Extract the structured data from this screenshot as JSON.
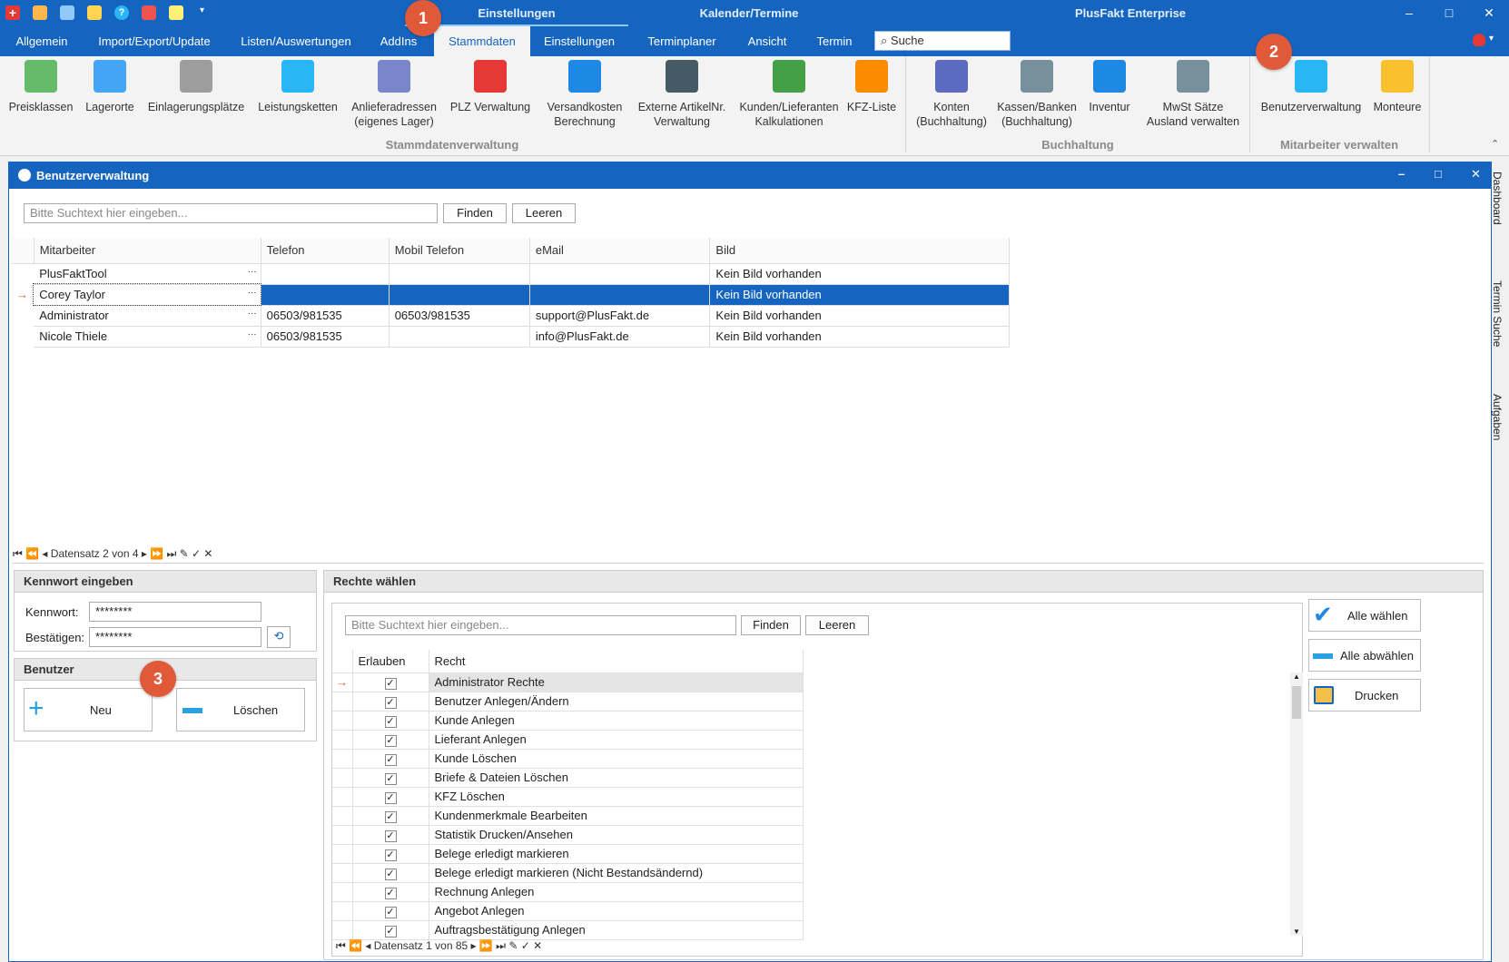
{
  "titlebar": {
    "context_tab1": "Einstellungen",
    "context_tab2": "Kalender/Termine",
    "app_title": "PlusFakt Enterprise"
  },
  "ribbon_tabs": [
    "Allgemein",
    "Import/Export/Update",
    "Listen/Auswertungen",
    "AddIns",
    "Stammdaten",
    "Einstellungen",
    "Terminplaner",
    "Ansicht",
    "Termin"
  ],
  "search_label": "Suche",
  "ribbon": {
    "buttons": [
      {
        "label": "Preisklassen",
        "icon": "money-icon"
      },
      {
        "label": "Lagerorte",
        "icon": "factory-icon"
      },
      {
        "label": "Einlagerungsplätze",
        "icon": "warehouse-icon"
      },
      {
        "label": "Leistungsketten",
        "icon": "chain-icon"
      },
      {
        "label": "Anlieferadressen\n(eigenes Lager)",
        "icon": "delivery-address-icon"
      },
      {
        "label": "PLZ Verwaltung",
        "icon": "plz-icon"
      },
      {
        "label": "Versandkosten\nBerechnung",
        "icon": "truck-icon"
      },
      {
        "label": "Externe ArtikelNr.\nVerwaltung",
        "icon": "barcode-icon"
      },
      {
        "label": "Kunden/Lieferanten\nKalkulationen",
        "icon": "calc-icon"
      },
      {
        "label": "KFZ-Liste",
        "icon": "car-icon"
      },
      {
        "label": "Konten\n(Buchhaltung)",
        "icon": "bank-icon"
      },
      {
        "label": "Kassen/Banken\n(Buchhaltung)",
        "icon": "cash-register-icon"
      },
      {
        "label": "Inventur",
        "icon": "forklift-icon"
      },
      {
        "label": "MwSt Sätze\nAusland verwalten",
        "icon": "tax-register-icon"
      },
      {
        "label": "Benutzerverwaltung",
        "icon": "user-management-icon"
      },
      {
        "label": "Monteure",
        "icon": "worker-icon"
      }
    ],
    "groups": [
      "Stammdatenverwaltung",
      "Buchhaltung",
      "Mitarbeiter verwalten"
    ]
  },
  "badges": [
    "1",
    "2",
    "3"
  ],
  "window": {
    "title": "Benutzerverwaltung",
    "search_placeholder": "Bitte Suchtext hier eingeben...",
    "find_label": "Finden",
    "clear_label": "Leeren",
    "columns": [
      "Mitarbeiter",
      "Telefon",
      "Mobil Telefon",
      "eMail",
      "Bild"
    ],
    "rows": [
      {
        "name": "PlusFaktTool",
        "phone": "",
        "mobile": "",
        "email": "",
        "image": "Kein Bild vorhanden"
      },
      {
        "name": "Corey Taylor",
        "phone": "",
        "mobile": "",
        "email": "",
        "image": "Kein Bild vorhanden"
      },
      {
        "name": "Administrator",
        "phone": "06503/981535",
        "mobile": "06503/981535",
        "email": "support@PlusFakt.de",
        "image": "Kein Bild vorhanden"
      },
      {
        "name": "Nicole Thiele",
        "phone": "06503/981535",
        "mobile": "",
        "email": "info@PlusFakt.de",
        "image": "Kein Bild vorhanden"
      }
    ],
    "ellipsis": "···",
    "nav_text": "Datensatz 2 von 4",
    "side_tabs": [
      "Dashboard",
      "Termin Suche",
      "Aufgaben"
    ]
  },
  "password": {
    "header": "Kennwort eingeben",
    "password_label": "Kennwort:",
    "password_value": "********",
    "confirm_label": "Bestätigen:",
    "confirm_value": "********"
  },
  "user": {
    "header": "Benutzer",
    "new_label": "Neu",
    "delete_label": "Löschen"
  },
  "rights": {
    "header": "Rechte wählen",
    "search_placeholder": "Bitte Suchtext hier eingeben...",
    "find_label": "Finden",
    "clear_label": "Leeren",
    "col_allow": "Erlauben",
    "col_right": "Recht",
    "items": [
      "Administrator Rechte",
      "Benutzer Anlegen/Ändern",
      "Kunde Anlegen",
      "Lieferant Anlegen",
      "Kunde Löschen",
      "Briefe & Dateien Löschen",
      "KFZ Löschen",
      "Kundenmerkmale Bearbeiten",
      "Statistik Drucken/Ansehen",
      "Belege erledigt markieren",
      "Belege erledigt markieren (Nicht Bestandsändernd)",
      "Rechnung Anlegen",
      "Angebot Anlegen",
      "Auftragsbestätigung Anlegen"
    ],
    "nav_text": "Datensatz 1 von 85",
    "select_all": "Alle wählen",
    "deselect_all": "Alle abwählen",
    "print": "Drucken"
  },
  "colors": {
    "accent": "#1565c0",
    "badge": "#e05a3a",
    "selected_row": "#1565c0"
  }
}
